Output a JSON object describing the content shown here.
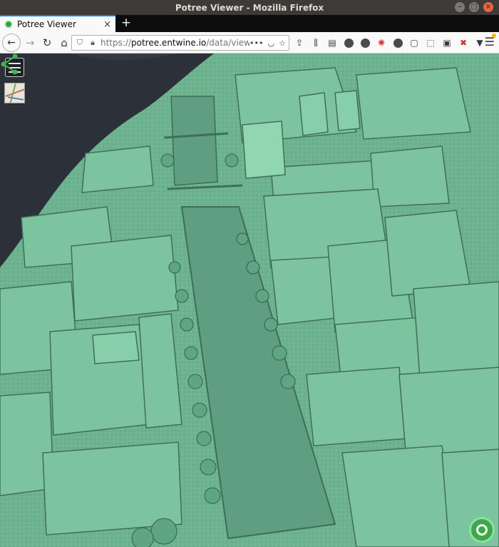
{
  "window": {
    "title": "Potree Viewer - Mozilla Firefox"
  },
  "tab": {
    "title": "Potree Viewer",
    "close_label": "×"
  },
  "newtab_label": "+",
  "navbar": {
    "url_scheme": "https://",
    "url_host": "potree.entwine.io",
    "url_path": "/data/view",
    "overflow_label": "•••"
  },
  "viewer": {
    "background_sky": "#2c3039",
    "pointcloud_color": "#6fb893",
    "icons": [
      "menu-icon",
      "map-icon",
      "share-icon",
      "potree-logo"
    ]
  }
}
